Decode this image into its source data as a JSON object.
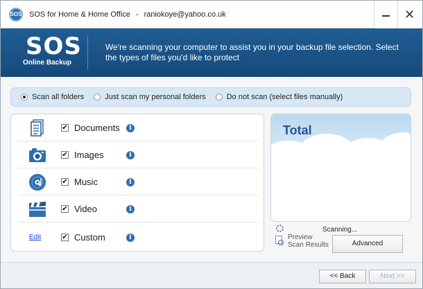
{
  "window": {
    "app_name": "SOS for Home & Home Office",
    "separator": "-",
    "account": "raniokoye@yahoo.co.uk",
    "logo_text": "SOS"
  },
  "banner": {
    "logo_title": "SOS",
    "logo_subtitle": "Online Backup",
    "message": "We're scanning your computer to assist you in your backup file selection. Select the types of files you'd like to protect"
  },
  "scan_options": [
    {
      "label": "Scan all folders",
      "selected": true
    },
    {
      "label": "Just scan my personal folders",
      "selected": false
    },
    {
      "label": "Do not scan (select files manually)",
      "selected": false
    }
  ],
  "file_types": [
    {
      "label": "Documents",
      "icon": "documents-icon",
      "checked": true
    },
    {
      "label": "Images",
      "icon": "camera-icon",
      "checked": true
    },
    {
      "label": "Music",
      "icon": "music-disc-icon",
      "checked": true
    },
    {
      "label": "Video",
      "icon": "clapperboard-icon",
      "checked": true
    },
    {
      "label": "Custom",
      "edit_label": "Edit",
      "checked": true
    }
  ],
  "checkmark": "✔",
  "info_glyph": "i",
  "total": {
    "title": "Total"
  },
  "scan_status": "Scanning...",
  "preview_label": "Preview Scan Results",
  "advanced_label": "Advanced",
  "footer": {
    "back_label": "<< Back",
    "next_label": "Next >>",
    "next_enabled": false
  },
  "colors": {
    "banner": "#1f5d94",
    "accent": "#2f6fb0",
    "scan_bar": "#d7e7f4",
    "total_title": "#1d5a93"
  }
}
